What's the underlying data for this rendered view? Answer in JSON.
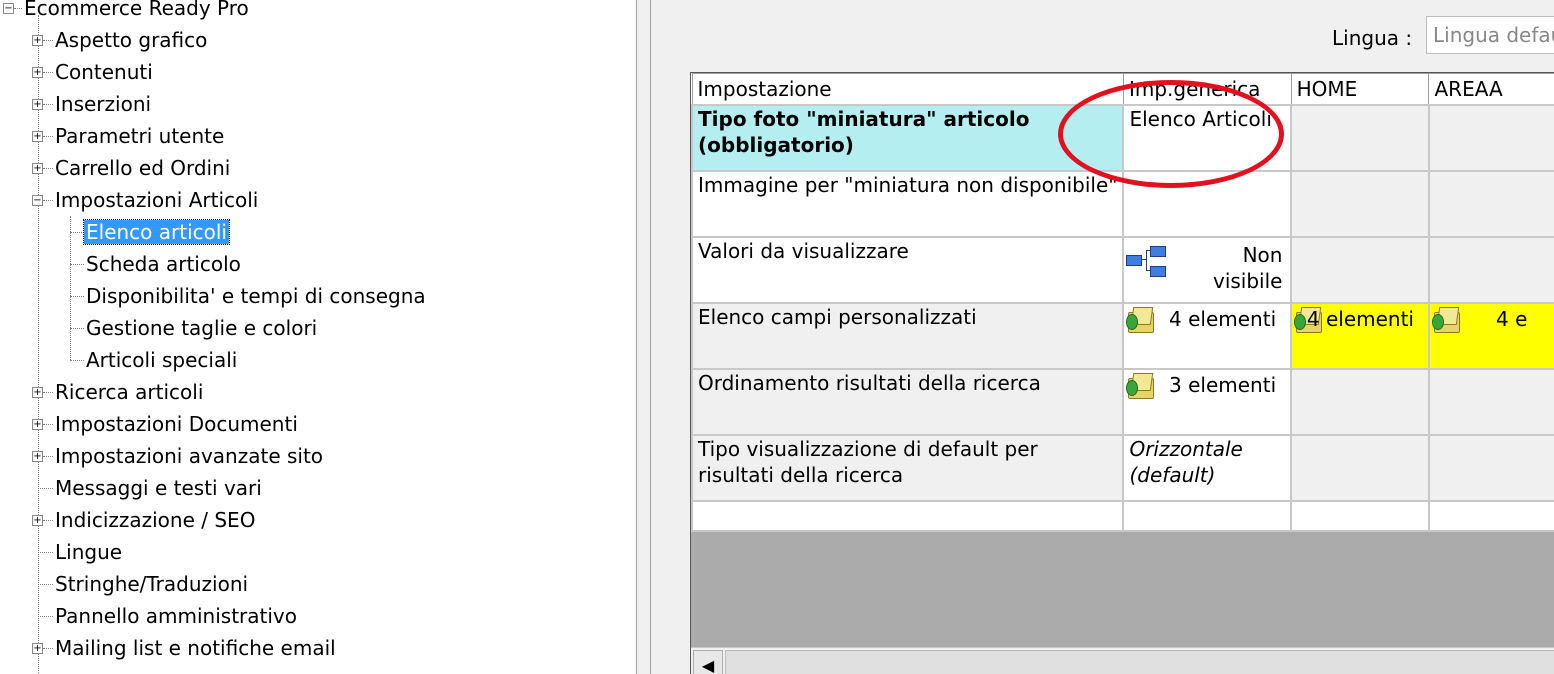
{
  "tree": {
    "root": "Ecommerce Ready Pro",
    "items": [
      {
        "label": "Aspetto grafico",
        "expander": "+"
      },
      {
        "label": "Contenuti",
        "expander": "+"
      },
      {
        "label": "Inserzioni",
        "expander": "+"
      },
      {
        "label": "Parametri utente",
        "expander": "+"
      },
      {
        "label": "Carrello ed Ordini",
        "expander": "+"
      },
      {
        "label": "Impostazioni Articoli",
        "expander": "−"
      },
      {
        "label": "Ricerca articoli",
        "expander": "+"
      },
      {
        "label": "Impostazioni Documenti",
        "expander": "+"
      },
      {
        "label": "Impostazioni avanzate sito",
        "expander": "+"
      },
      {
        "label": "Messaggi e testi vari",
        "expander": ""
      },
      {
        "label": "Indicizzazione / SEO",
        "expander": "+"
      },
      {
        "label": "Lingue",
        "expander": ""
      },
      {
        "label": "Stringhe/Traduzioni",
        "expander": ""
      },
      {
        "label": "Pannello amministrativo",
        "expander": ""
      },
      {
        "label": "Mailing list e notifiche email",
        "expander": "+"
      }
    ],
    "children": [
      {
        "label": "Elenco articoli",
        "selected": true
      },
      {
        "label": "Scheda articolo"
      },
      {
        "label": "Disponibilita' e tempi di consegna"
      },
      {
        "label": "Gestione taglie e colori"
      },
      {
        "label": "Articoli speciali"
      }
    ],
    "root_expander": "−"
  },
  "language": {
    "label": "Lingua :",
    "value": "Lingua default"
  },
  "grid": {
    "columns": [
      "Impostazione",
      "Imp.generica",
      "HOME",
      "AREAA"
    ],
    "rows": [
      {
        "setting": "Tipo foto \"miniatura\" articolo (obbligatorio)",
        "generic": "Elenco Articoli",
        "home": "",
        "areaa": ""
      },
      {
        "setting": "Immagine per \"miniatura non disponibile\"",
        "generic": "",
        "home": "",
        "areaa": ""
      },
      {
        "setting": "Valori da visualizzare",
        "generic": "Non visibile",
        "home": "",
        "areaa": ""
      },
      {
        "setting": "Elenco campi personalizzati",
        "generic": "4 elementi",
        "home": "4 elementi",
        "areaa": "4 e"
      },
      {
        "setting": "Ordinamento risultati della ricerca",
        "generic": "3 elementi",
        "home": "",
        "areaa": ""
      },
      {
        "setting": "Tipo visualizzazione di default per risultati della ricerca",
        "generic": "Orizzontale (default)",
        "home": "",
        "areaa": ""
      }
    ]
  },
  "colors": {
    "highlight_row": "#b5eef0",
    "yellow_cell": "#ffff00",
    "annotation_circle": "#e3101f",
    "selection": "#3399ff"
  },
  "icons": {
    "scroll_left": "◀"
  }
}
